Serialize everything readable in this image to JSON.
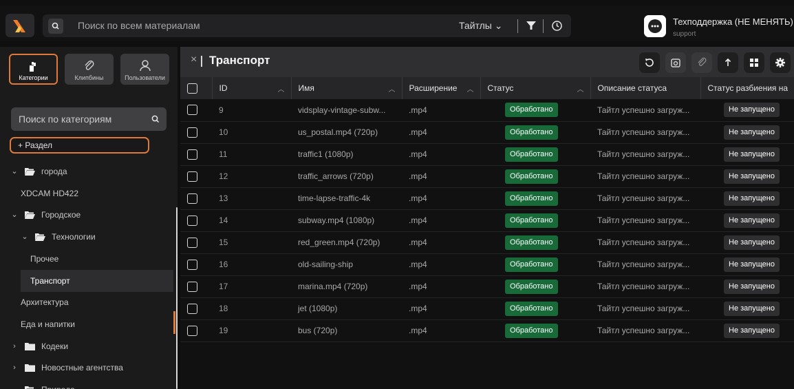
{
  "topbar": {
    "search_placeholder": "Поиск по всем материалам",
    "type_select": "Тайтлы",
    "user_name": "Техподдержка (НЕ МЕНЯТЬ)",
    "user_role": "support"
  },
  "sidebar": {
    "tabs": [
      {
        "label": "Категории",
        "icon": "categories-icon",
        "active": true
      },
      {
        "label": "Клипбины",
        "icon": "paperclip-icon",
        "active": false
      },
      {
        "label": "Пользователи",
        "icon": "user-icon",
        "active": false
      }
    ],
    "category_search_placeholder": "Поиск по категориям",
    "add_section_label": "+ Раздел",
    "tree": [
      {
        "label": "города",
        "chevron": "open",
        "folder": "open",
        "level": 0
      },
      {
        "label": "XDCAM HD422",
        "chevron": "none",
        "folder": "none",
        "level": 1
      },
      {
        "label": "Городское",
        "chevron": "open",
        "folder": "open",
        "level": 0
      },
      {
        "label": "Технологии",
        "chevron": "open",
        "folder": "open",
        "level": 1
      },
      {
        "label": "Прочее",
        "chevron": "none",
        "folder": "none",
        "level": 2
      },
      {
        "label": "Транспорт",
        "chevron": "none",
        "folder": "none",
        "level": 2,
        "selected": true
      },
      {
        "label": "Архитектура",
        "chevron": "none",
        "folder": "none",
        "level": 1
      },
      {
        "label": "Еда и напитки",
        "chevron": "none",
        "folder": "none",
        "level": 1
      },
      {
        "label": "Кодеки",
        "chevron": "closed",
        "folder": "closed",
        "level": 0
      },
      {
        "label": "Новостные агентства",
        "chevron": "closed",
        "folder": "closed",
        "level": 0
      },
      {
        "label": "Природа",
        "chevron": "open",
        "folder": "open",
        "level": 0
      }
    ]
  },
  "main": {
    "title": "Транспорт",
    "close_label": "×",
    "toolbar": [
      {
        "icon": "refresh-icon"
      },
      {
        "icon": "camera-icon"
      },
      {
        "icon": "paperclip-icon"
      },
      {
        "icon": "upload-icon"
      },
      {
        "icon": "grid-view-icon"
      },
      {
        "icon": "settings-icon"
      }
    ],
    "columns": [
      "ID",
      "Имя",
      "Расширение",
      "Статус",
      "Описание статуса",
      "Статус разбиения на"
    ],
    "rows": [
      {
        "id": "9",
        "name": "vidsplay-vintage-subw...",
        "ext": ".mp4",
        "status": "Обработано",
        "desc": "Тайтл успешно загруж...",
        "split": "Не запущено"
      },
      {
        "id": "10",
        "name": "us_postal.mp4 (720p)",
        "ext": ".mp4",
        "status": "Обработано",
        "desc": "Тайтл успешно загруж...",
        "split": "Не запущено"
      },
      {
        "id": "11",
        "name": "traffic1 (1080p)",
        "ext": ".mp4",
        "status": "Обработано",
        "desc": "Тайтл успешно загруж...",
        "split": "Не запущено"
      },
      {
        "id": "12",
        "name": "traffic_arrows (720p)",
        "ext": ".mp4",
        "status": "Обработано",
        "desc": "Тайтл успешно загруж...",
        "split": "Не запущено"
      },
      {
        "id": "13",
        "name": "time-lapse-traffic-4k",
        "ext": ".mp4",
        "status": "Обработано",
        "desc": "Тайтл успешно загруж...",
        "split": "Не запущено"
      },
      {
        "id": "14",
        "name": "subway.mp4 (1080p)",
        "ext": ".mp4",
        "status": "Обработано",
        "desc": "Тайтл успешно загруж...",
        "split": "Не запущено"
      },
      {
        "id": "15",
        "name": "red_green.mp4 (720p)",
        "ext": ".mp4",
        "status": "Обработано",
        "desc": "Тайтл успешно загруж...",
        "split": "Не запущено"
      },
      {
        "id": "16",
        "name": "old-sailing-ship",
        "ext": ".mp4",
        "status": "Обработано",
        "desc": "Тайтл успешно загруж...",
        "split": "Не запущено"
      },
      {
        "id": "17",
        "name": "marina.mp4 (720p)",
        "ext": ".mp4",
        "status": "Обработано",
        "desc": "Тайтл успешно загруж...",
        "split": "Не запущено"
      },
      {
        "id": "18",
        "name": "jet (1080p)",
        "ext": ".mp4",
        "status": "Обработано",
        "desc": "Тайтл успешно загруж...",
        "split": "Не запущено"
      },
      {
        "id": "19",
        "name": "bus (720p)",
        "ext": ".mp4",
        "status": "Обработано",
        "desc": "Тайтл успешно загруж...",
        "split": "Не запущено"
      }
    ]
  },
  "colors": {
    "accent": "#e07a3b",
    "success": "#186b39",
    "background": "#0f0f10",
    "panel": "#2f2f31"
  }
}
